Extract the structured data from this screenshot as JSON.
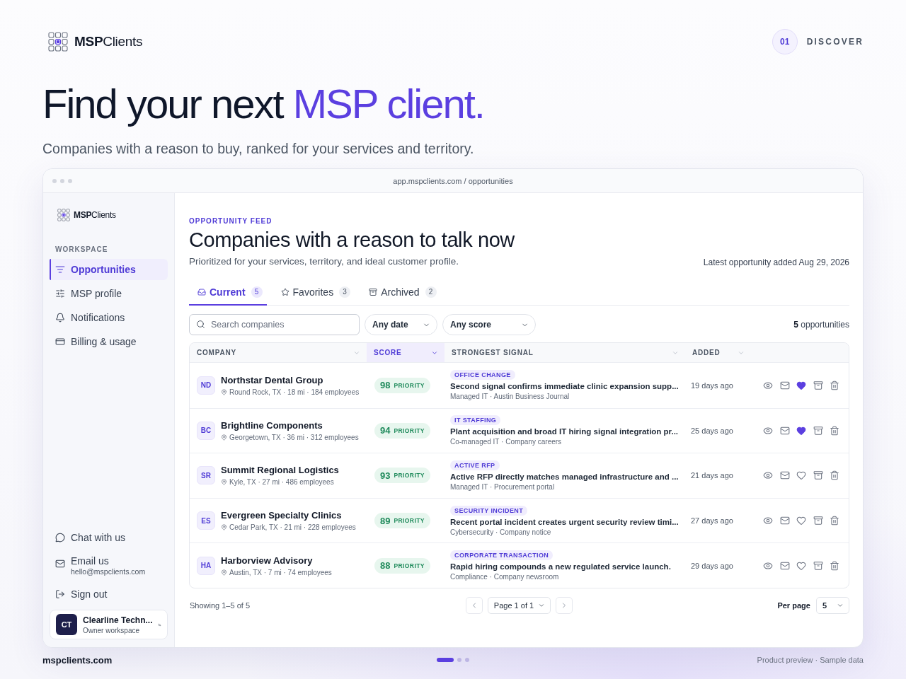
{
  "brand": {
    "name_bold": "MSP",
    "name_rest": "Clients"
  },
  "step": {
    "number": "01",
    "label": "DISCOVER"
  },
  "hero": {
    "title": "Find your next ",
    "title_highlight": "MSP client.",
    "subtitle": "Companies with a reason to buy, ranked for your services and territory."
  },
  "browser": {
    "url": "app.mspclients.com / opportunities"
  },
  "sidebar": {
    "brand": {
      "name_bold": "MSP",
      "name_rest": "Clients"
    },
    "section": "WORKSPACE",
    "items": [
      {
        "label": "Opportunities",
        "selected": true
      },
      {
        "label": "MSP profile",
        "selected": false
      },
      {
        "label": "Notifications",
        "selected": false
      },
      {
        "label": "Billing & usage",
        "selected": false
      }
    ],
    "support_items": [
      {
        "label": "Chat with us"
      },
      {
        "label": "Email us",
        "detail": "hello@mspclients.com"
      },
      {
        "label": "Sign out"
      }
    ],
    "account": {
      "initials": "CT",
      "name": "Clearline Techn...",
      "role": "Owner workspace"
    }
  },
  "main": {
    "eyebrow": "OPPORTUNITY FEED",
    "title": "Companies with a reason to talk now",
    "subtitle": "Prioritized for your services, territory, and ideal customer profile.",
    "updated": "Latest opportunity added Aug 29, 2026",
    "tabs": [
      {
        "label": "Current",
        "count": "5",
        "selected": true
      },
      {
        "label": "Favorites",
        "count": "3",
        "selected": false
      },
      {
        "label": "Archived",
        "count": "2",
        "selected": false
      }
    ],
    "search": {
      "placeholder": "Search companies"
    },
    "filters": [
      {
        "value": "Any date"
      },
      {
        "value": "Any score"
      }
    ],
    "result_count": "**5** opportunities",
    "table": {
      "columns": [
        {
          "label": "COMPANY",
          "selected": false
        },
        {
          "label": "SCORE",
          "selected": true
        },
        {
          "label": "STRONGEST SIGNAL",
          "selected": false
        },
        {
          "label": "ADDED",
          "selected": false
        }
      ],
      "rows": [
        {
          "initials": "ND",
          "name": "Northstar Dental Group",
          "details": "Round Rock, TX · 18 mi · 184 employees",
          "score": "98",
          "score_label": "PRIORITY",
          "signal_tag": "OFFICE CHANGE",
          "signal": "Second signal confirms immediate clinic expansion supp...",
          "signal_source": "Managed IT · Austin Business Journal",
          "added": "19 days ago",
          "favorited": true
        },
        {
          "initials": "BC",
          "name": "Brightline Components",
          "details": "Georgetown, TX · 36 mi · 312 employees",
          "score": "94",
          "score_label": "PRIORITY",
          "signal_tag": "IT STAFFING",
          "signal": "Plant acquisition and broad IT hiring signal integration pr...",
          "signal_source": "Co-managed IT · Company careers",
          "added": "25 days ago",
          "favorited": true
        },
        {
          "initials": "SR",
          "name": "Summit Regional Logistics",
          "details": "Kyle, TX · 27 mi · 486 employees",
          "score": "93",
          "score_label": "PRIORITY",
          "signal_tag": "ACTIVE RFP",
          "signal": "Active RFP directly matches managed infrastructure and ...",
          "signal_source": "Managed IT · Procurement portal",
          "added": "21 days ago",
          "favorited": false
        },
        {
          "initials": "ES",
          "name": "Evergreen Specialty Clinics",
          "details": "Cedar Park, TX · 21 mi · 228 employees",
          "score": "89",
          "score_label": "PRIORITY",
          "signal_tag": "SECURITY INCIDENT",
          "signal": "Recent portal incident creates urgent security review timi...",
          "signal_source": "Cybersecurity · Company notice",
          "added": "27 days ago",
          "favorited": false
        },
        {
          "initials": "HA",
          "name": "Harborview Advisory",
          "details": "Austin, TX · 7 mi · 74 employees",
          "score": "88",
          "score_label": "PRIORITY",
          "signal_tag": "CORPORATE TRANSACTION",
          "signal": "Rapid hiring compounds a new regulated service launch.",
          "signal_source": "Compliance · Company newsroom",
          "added": "29 days ago",
          "favorited": false
        }
      ]
    },
    "pagination": {
      "summary": "Showing 1–5 of 5",
      "page": "Page 1 of 1",
      "per_page_label": "Per page",
      "per_page": "5"
    }
  },
  "footer": {
    "site": "mspclients.com",
    "slides": [
      {
        "selected": true
      },
      {
        "selected": false
      },
      {
        "selected": false
      }
    ],
    "note": "Product preview · Sample data"
  }
}
